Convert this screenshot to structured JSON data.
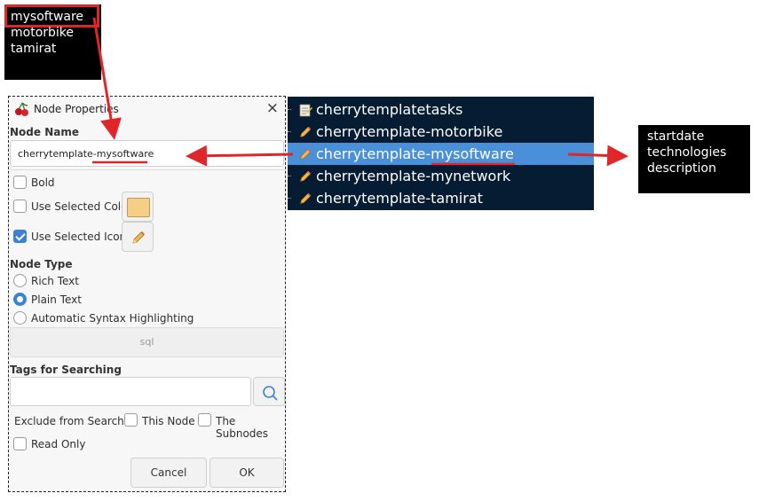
{
  "top_box": {
    "lines": [
      "mysoftware",
      "motorbike",
      "tamirat"
    ]
  },
  "right_box": {
    "lines": [
      "startdate",
      "technologies",
      "description"
    ]
  },
  "dialog": {
    "title": "Node Properties",
    "close_label": "×",
    "node_name_label": "Node Name",
    "node_name_value": "cherrytemplate-mysoftware",
    "bold_label": "Bold",
    "use_selected_color_label": "Use Selected Color",
    "selected_color": "#f4cf85",
    "use_selected_icon_label": "Use Selected Icon",
    "selected_icon": "pencil-icon",
    "node_type_label": "Node Type",
    "node_types": [
      "Rich Text",
      "Plain Text",
      "Automatic Syntax Highlighting"
    ],
    "selected_node_type": "Plain Text",
    "syntax_value": "sql",
    "tags_label": "Tags for Searching",
    "tags_value": "",
    "exclude_label": "Exclude from Searches",
    "this_node_label": "This Node",
    "subnodes_label": "The Subnodes",
    "read_only_label": "Read Only",
    "cancel_label": "Cancel",
    "ok_label": "OK",
    "checks": {
      "bold": false,
      "use_selected_color": false,
      "use_selected_icon": true,
      "this_node": false,
      "subnodes": false,
      "read_only": false
    }
  },
  "tree": {
    "nodes": [
      {
        "label": "cherrytemplatetasks",
        "icon": "notepad-icon",
        "selected": false
      },
      {
        "label": "cherrytemplate-motorbike",
        "icon": "pencil-icon",
        "selected": false
      },
      {
        "label": "cherrytemplate-mysoftware",
        "icon": "pencil-icon",
        "selected": true
      },
      {
        "label": "cherrytemplate-mynetwork",
        "icon": "pencil-icon",
        "selected": false
      },
      {
        "label": "cherrytemplate-tamirat",
        "icon": "pencil-icon",
        "selected": false
      }
    ]
  },
  "colors": {
    "annotation": "#e0262a",
    "tree_bg": "#061c33",
    "tree_selected": "#4a90d9",
    "accent": "#3b82d6"
  }
}
